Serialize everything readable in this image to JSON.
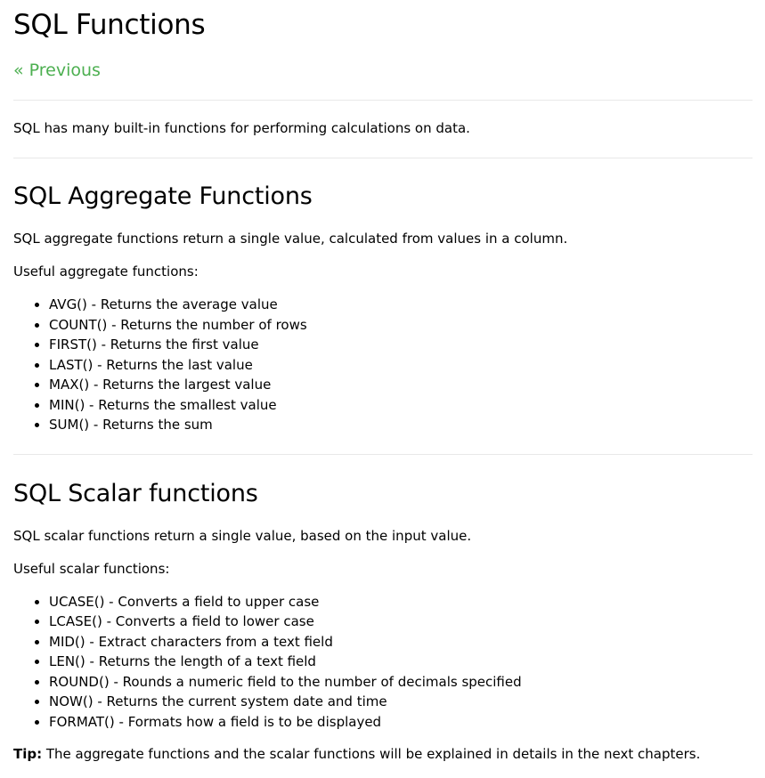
{
  "page": {
    "title": "SQL Functions",
    "prev_link": "« Previous",
    "intro": "SQL has many built-in functions for performing calculations on data."
  },
  "aggregate": {
    "heading": "SQL Aggregate Functions",
    "description": "SQL aggregate functions return a single value, calculated from values in a column.",
    "useful": "Useful aggregate functions:",
    "items": [
      "AVG() - Returns the average value",
      "COUNT() - Returns the number of rows",
      "FIRST() - Returns the first value",
      "LAST() - Returns the last value",
      "MAX() - Returns the largest value",
      "MIN() - Returns the smallest value",
      "SUM() - Returns the sum"
    ]
  },
  "scalar": {
    "heading": "SQL Scalar functions",
    "description": "SQL scalar functions return a single value, based on the input value.",
    "useful": "Useful scalar functions:",
    "items": [
      "UCASE() - Converts a field to upper case",
      "LCASE() - Converts a field to lower case",
      "MID() - Extract characters from a text field",
      "LEN() - Returns the length of a text field",
      "ROUND() - Rounds a numeric field to the number of decimals specified",
      "NOW() - Returns the current system date and time",
      "FORMAT() - Formats how a field is to be displayed"
    ]
  },
  "tip": {
    "label": "Tip:",
    "text": " The aggregate functions and the scalar functions will be explained in details in the next chapters."
  },
  "colors": {
    "link": "#4CAF50",
    "divider": "#e8e8e8",
    "text": "#000000"
  }
}
